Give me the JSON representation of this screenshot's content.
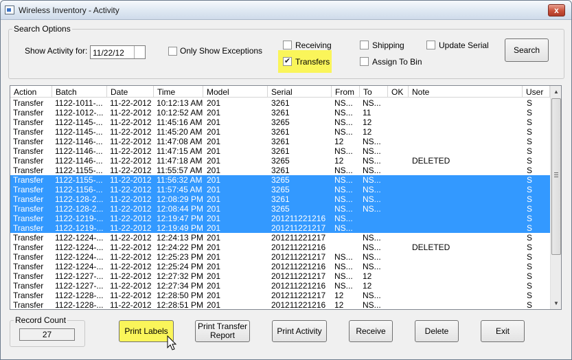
{
  "window": {
    "title": "Wireless Inventory - Activity",
    "close_glyph": "x"
  },
  "search_options": {
    "legend": "Search Options",
    "show_activity_label": "Show Activity for:",
    "date_value": "11/22/12",
    "only_exceptions_label": "Only Show Exceptions",
    "only_exceptions_checked": false,
    "receiving_label": "Receiving",
    "receiving_checked": false,
    "transfers_label": "Transfers",
    "transfers_checked": true,
    "shipping_label": "Shipping",
    "shipping_checked": false,
    "assign_to_bin_label": "Assign To Bin",
    "assign_to_bin_checked": false,
    "update_serial_label": "Update Serial",
    "update_serial_checked": false,
    "search_button": "Search",
    "highlight_color": "#faf55a"
  },
  "grid": {
    "columns": [
      "Action",
      "Batch",
      "Date",
      "Time",
      "Model",
      "Serial",
      "From",
      "To",
      "OK",
      "Note",
      "User"
    ],
    "selection_color": "#3399ff",
    "rows": [
      {
        "action": "Transfer",
        "batch": "1122-1011-...",
        "date": "11-22-2012",
        "time": "10:12:13 AM",
        "model": "201",
        "serial": "3261",
        "from": "NS...",
        "to": "NS...",
        "ok": "",
        "note": "",
        "user": "S",
        "selected": false
      },
      {
        "action": "Transfer",
        "batch": "1122-1012-...",
        "date": "11-22-2012",
        "time": "10:12:52 AM",
        "model": "201",
        "serial": "3261",
        "from": "NS...",
        "to": "11",
        "ok": "",
        "note": "",
        "user": "S",
        "selected": false
      },
      {
        "action": "Transfer",
        "batch": "1122-1145-...",
        "date": "11-22-2012",
        "time": "11:45:16 AM",
        "model": "201",
        "serial": "3265",
        "from": "NS...",
        "to": "12",
        "ok": "",
        "note": "",
        "user": "S",
        "selected": false
      },
      {
        "action": "Transfer",
        "batch": "1122-1145-...",
        "date": "11-22-2012",
        "time": "11:45:20 AM",
        "model": "201",
        "serial": "3261",
        "from": "NS...",
        "to": "12",
        "ok": "",
        "note": "",
        "user": "S",
        "selected": false
      },
      {
        "action": "Transfer",
        "batch": "1122-1146-...",
        "date": "11-22-2012",
        "time": "11:47:08 AM",
        "model": "201",
        "serial": "3261",
        "from": "12",
        "to": "NS...",
        "ok": "",
        "note": "",
        "user": "S",
        "selected": false
      },
      {
        "action": "Transfer",
        "batch": "1122-1146-...",
        "date": "11-22-2012",
        "time": "11:47:15 AM",
        "model": "201",
        "serial": "3261",
        "from": "NS...",
        "to": "NS...",
        "ok": "",
        "note": "",
        "user": "S",
        "selected": false
      },
      {
        "action": "Transfer",
        "batch": "1122-1146-...",
        "date": "11-22-2012",
        "time": "11:47:18 AM",
        "model": "201",
        "serial": "3265",
        "from": "12",
        "to": "NS...",
        "ok": "",
        "note": "DELETED",
        "user": "S",
        "selected": false
      },
      {
        "action": "Transfer",
        "batch": "1122-1155-...",
        "date": "11-22-2012",
        "time": "11:55:57 AM",
        "model": "201",
        "serial": "3261",
        "from": "NS...",
        "to": "NS...",
        "ok": "",
        "note": "",
        "user": "S",
        "selected": false
      },
      {
        "action": "Transfer",
        "batch": "1122-1155-...",
        "date": "11-22-2012",
        "time": "11:56:32 AM",
        "model": "201",
        "serial": "3265",
        "from": "NS...",
        "to": "NS...",
        "ok": "",
        "note": "",
        "user": "S",
        "selected": true
      },
      {
        "action": "Transfer",
        "batch": "1122-1156-...",
        "date": "11-22-2012",
        "time": "11:57:45 AM",
        "model": "201",
        "serial": "3265",
        "from": "NS...",
        "to": "NS...",
        "ok": "",
        "note": "",
        "user": "S",
        "selected": true
      },
      {
        "action": "Transfer",
        "batch": "1122-128-2...",
        "date": "11-22-2012",
        "time": "12:08:29 PM",
        "model": "201",
        "serial": "3261",
        "from": "NS...",
        "to": "NS...",
        "ok": "",
        "note": "",
        "user": "S",
        "selected": true
      },
      {
        "action": "Transfer",
        "batch": "1122-128-2...",
        "date": "11-22-2012",
        "time": "12:08:44 PM",
        "model": "201",
        "serial": "3265",
        "from": "NS...",
        "to": "NS...",
        "ok": "",
        "note": "",
        "user": "S",
        "selected": true
      },
      {
        "action": "Transfer",
        "batch": "1122-1219-...",
        "date": "11-22-2012",
        "time": "12:19:47 PM",
        "model": "201",
        "serial": "201211221216",
        "from": "NS...",
        "to": "",
        "ok": "",
        "note": "",
        "user": "S",
        "selected": true
      },
      {
        "action": "Transfer",
        "batch": "1122-1219-...",
        "date": "11-22-2012",
        "time": "12:19:49 PM",
        "model": "201",
        "serial": "201211221217",
        "from": "NS...",
        "to": "",
        "ok": "",
        "note": "",
        "user": "S",
        "selected": true
      },
      {
        "action": "Transfer",
        "batch": "1122-1224-...",
        "date": "11-22-2012",
        "time": "12:24:13 PM",
        "model": "201",
        "serial": "201211221217",
        "from": "",
        "to": "NS...",
        "ok": "",
        "note": "",
        "user": "S",
        "selected": false
      },
      {
        "action": "Transfer",
        "batch": "1122-1224-...",
        "date": "11-22-2012",
        "time": "12:24:22 PM",
        "model": "201",
        "serial": "201211221216",
        "from": "",
        "to": "NS...",
        "ok": "",
        "note": "DELETED",
        "user": "S",
        "selected": false
      },
      {
        "action": "Transfer",
        "batch": "1122-1224-...",
        "date": "11-22-2012",
        "time": "12:25:23 PM",
        "model": "201",
        "serial": "201211221217",
        "from": "NS...",
        "to": "NS...",
        "ok": "",
        "note": "",
        "user": "S",
        "selected": false
      },
      {
        "action": "Transfer",
        "batch": "1122-1224-...",
        "date": "11-22-2012",
        "time": "12:25:24 PM",
        "model": "201",
        "serial": "201211221216",
        "from": "NS...",
        "to": "NS...",
        "ok": "",
        "note": "",
        "user": "S",
        "selected": false
      },
      {
        "action": "Transfer",
        "batch": "1122-1227-...",
        "date": "11-22-2012",
        "time": "12:27:32 PM",
        "model": "201",
        "serial": "201211221217",
        "from": "NS...",
        "to": "12",
        "ok": "",
        "note": "",
        "user": "S",
        "selected": false
      },
      {
        "action": "Transfer",
        "batch": "1122-1227-...",
        "date": "11-22-2012",
        "time": "12:27:34 PM",
        "model": "201",
        "serial": "201211221216",
        "from": "NS...",
        "to": "12",
        "ok": "",
        "note": "",
        "user": "S",
        "selected": false
      },
      {
        "action": "Transfer",
        "batch": "1122-1228-...",
        "date": "11-22-2012",
        "time": "12:28:50 PM",
        "model": "201",
        "serial": "201211221217",
        "from": "12",
        "to": "NS...",
        "ok": "",
        "note": "",
        "user": "S",
        "selected": false
      },
      {
        "action": "Transfer",
        "batch": "1122-1228-...",
        "date": "11-22-2012",
        "time": "12:28:51 PM",
        "model": "201",
        "serial": "201211221216",
        "from": "12",
        "to": "NS...",
        "ok": "",
        "note": "",
        "user": "S",
        "selected": false
      }
    ]
  },
  "record_count": {
    "legend": "Record Count",
    "value": "27"
  },
  "buttons": {
    "print_labels": "Print Labels",
    "print_transfer_report_line1": "Print Transfer",
    "print_transfer_report_line2": "Report",
    "print_activity": "Print Activity",
    "receive": "Receive",
    "delete": "Delete",
    "exit": "Exit"
  },
  "icons": {
    "app": "app-window-icon",
    "scroll_up": "▲",
    "scroll_down": "▼",
    "check": "✔"
  }
}
